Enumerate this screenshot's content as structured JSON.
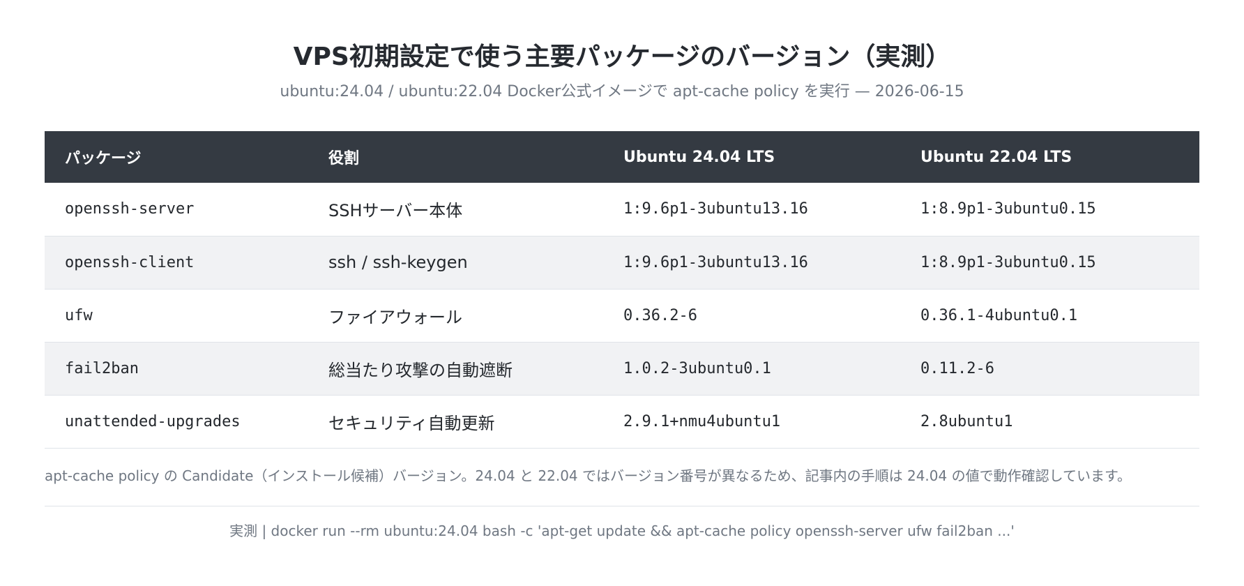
{
  "title": "VPS初期設定で使う主要パッケージのバージョン（実測）",
  "subtitle": "ubuntu:24.04 / ubuntu:22.04 Docker公式イメージで apt-cache policy を実行 — 2026-06-15",
  "table": {
    "headers": [
      "パッケージ",
      "役割",
      "Ubuntu 24.04 LTS",
      "Ubuntu 22.04 LTS"
    ],
    "rows": [
      {
        "package": "openssh-server",
        "role": "SSHサーバー本体",
        "v2404": "1:9.6p1-3ubuntu13.16",
        "v2204": "1:8.9p1-3ubuntu0.15"
      },
      {
        "package": "openssh-client",
        "role": "ssh / ssh-keygen",
        "v2404": "1:9.6p1-3ubuntu13.16",
        "v2204": "1:8.9p1-3ubuntu0.15"
      },
      {
        "package": "ufw",
        "role": "ファイアウォール",
        "v2404": "0.36.2-6",
        "v2204": "0.36.1-4ubuntu0.1"
      },
      {
        "package": "fail2ban",
        "role": "総当たり攻撃の自動遮断",
        "v2404": "1.0.2-3ubuntu0.1",
        "v2204": "0.11.2-6"
      },
      {
        "package": "unattended-upgrades",
        "role": "セキュリティ自動更新",
        "v2404": "2.9.1+nmu4ubuntu1",
        "v2204": "2.8ubuntu1"
      }
    ]
  },
  "note": "apt-cache policy の Candidate（インストール候補）バージョン。24.04 と 22.04 ではバージョン番号が異なるため、記事内の手順は 24.04 の値で動作確認しています。",
  "source": "実測 | docker run --rm ubuntu:24.04 bash -c 'apt-get update && apt-cache policy openssh-server ufw fail2ban ...'"
}
